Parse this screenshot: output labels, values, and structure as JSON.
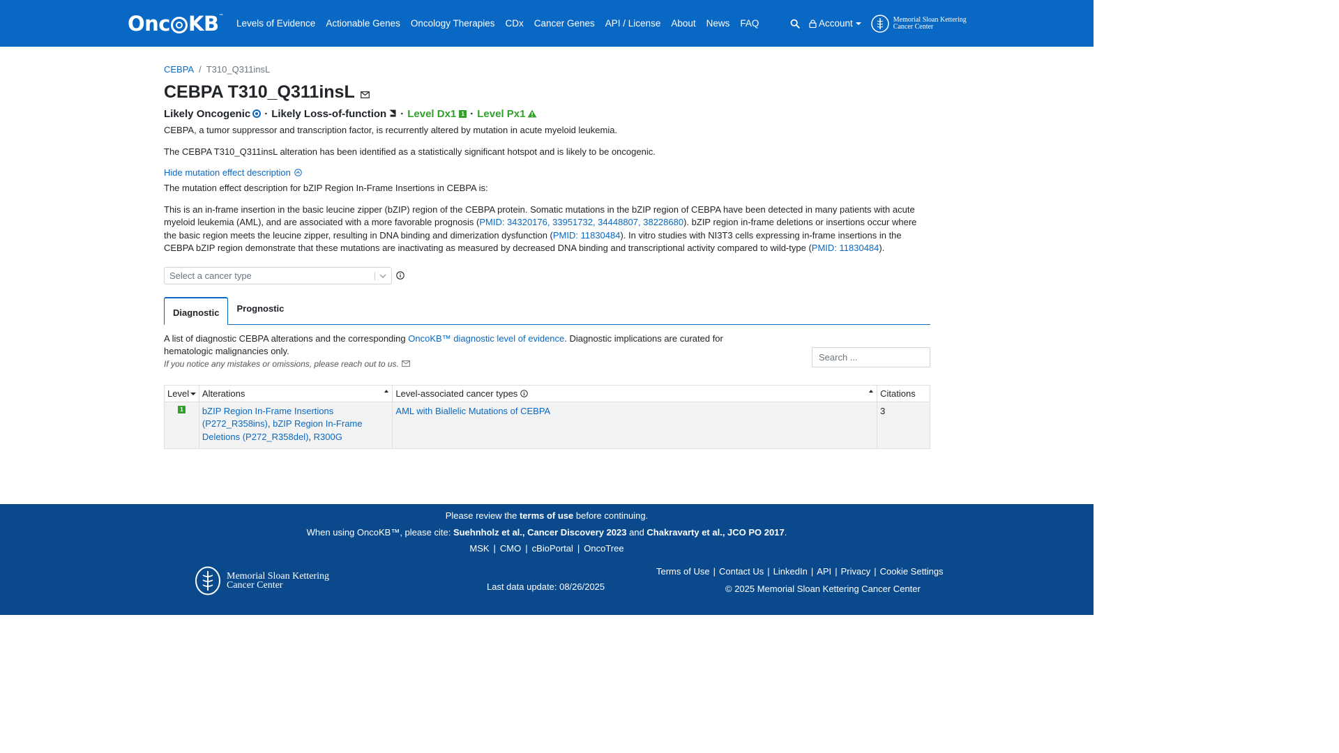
{
  "nav": {
    "logo": "OncoKB",
    "logo_tm": "™",
    "links": [
      "Levels of Evidence",
      "Actionable Genes",
      "Oncology Therapies",
      "CDx",
      "Cancer Genes",
      "API / License",
      "About",
      "News",
      "FAQ"
    ],
    "account_label": "Account",
    "msk_line1": "Memorial Sloan Kettering",
    "msk_line2": "Cancer Center",
    "brand_color": "#0968c3"
  },
  "breadcrumb": {
    "gene": "CEBPA",
    "separator": "/",
    "alteration": "T310_Q311insL"
  },
  "title": "CEBPA T310_Q311insL",
  "summary": {
    "oncogenicity": "Likely Oncogenic",
    "effect": "Likely Loss-of-function",
    "dot": "·",
    "level_dx": "Level Dx1",
    "level_px": "Level Px1",
    "dx_badge": "1",
    "level_color": "#33a02c"
  },
  "description": {
    "gene_summary": "CEBPA, a tumor suppressor and transcription factor, is recurrently altered by mutation in acute myeloid leukemia.",
    "variant_summary": "The CEBPA T310_Q311insL alteration has been identified as a statistically significant hotspot and is likely to be oncogenic.",
    "toggle_label": "Hide mutation effect description",
    "effect_intro": "The mutation effect description for bZIP Region In-Frame Insertions in CEBPA is:",
    "effect_part1": "This is an in-frame insertion in the basic leucine zipper (bZIP) region of the CEBPA protein. Somatic mutations in the bZIP region of CEBPA have been detected in many patients with acute myeloid leukemia (AML), and are associated with a more favorable prognosis (",
    "effect_ref1": "PMID: 34320176, 33951732, 34448807, 38228680",
    "effect_part2": "). bZIP region in-frame deletions or insertions occur where the basic region meets the leucine zipper, resulting in DNA binding and dimerization dysfunction (",
    "effect_ref2": "PMID: 11830484",
    "effect_part3": "). In vitro studies with NI3T3 cells expressing in-frame insertions in the CEBPA bZIP region demonstrate that these mutations are inactivating as measured by decreased DNA binding and transcriptional activity compared to wild-type (",
    "effect_ref3": "PMID: 11830484",
    "effect_part4": ")."
  },
  "cancer_select": {
    "placeholder": "Select a cancer type"
  },
  "tabs": [
    {
      "label": "Diagnostic",
      "active": true
    },
    {
      "label": "Prognostic",
      "active": false
    }
  ],
  "tab_desc": {
    "part1": "A list of diagnostic CEBPA alterations and the corresponding ",
    "link": "OncoKB™ diagnostic level of evidence",
    "part2": ". Diagnostic implications are curated for hematologic malignancies only.",
    "note": "If you notice any mistakes or omissions, please reach out to us."
  },
  "search": {
    "placeholder": "Search ..."
  },
  "table": {
    "headers": [
      "Level",
      "Alterations",
      "Level-associated cancer types",
      "Citations"
    ],
    "rows": [
      {
        "level": "1",
        "alt1": "bZIP Region In-Frame Insertions (P272_R358ins)",
        "alt2": "bZIP Region In-Frame Deletions (P272_R358del)",
        "alt3": "R300G",
        "cancer_type": "AML with Biallelic Mutations of CEBPA",
        "citations": "3"
      }
    ]
  },
  "footer": {
    "review_pre": "Please review the ",
    "review_link": "terms of use",
    "review_post": " before continuing.",
    "cite_pre": "When using OncoKB™, please cite: ",
    "cite1": "Suehnholz et al., Cancer Discovery 2023",
    "cite_and": " and ",
    "cite2": "Chakravarty et al., JCO PO 2017",
    "cite_post": ".",
    "partner_links": [
      "MSK",
      "CMO",
      "cBioPortal",
      "OncoTree"
    ],
    "msk_line1": "Memorial Sloan Kettering",
    "msk_line2": "Cancer Center",
    "last_update": "Last data update: 08/26/2025",
    "right_links": [
      "Terms of Use",
      "Contact Us",
      "LinkedIn",
      "API",
      "Privacy",
      "Cookie Settings"
    ],
    "copyright": "© 2025 Memorial Sloan Kettering Cancer Center",
    "bg_color": "#0a4a8c"
  }
}
